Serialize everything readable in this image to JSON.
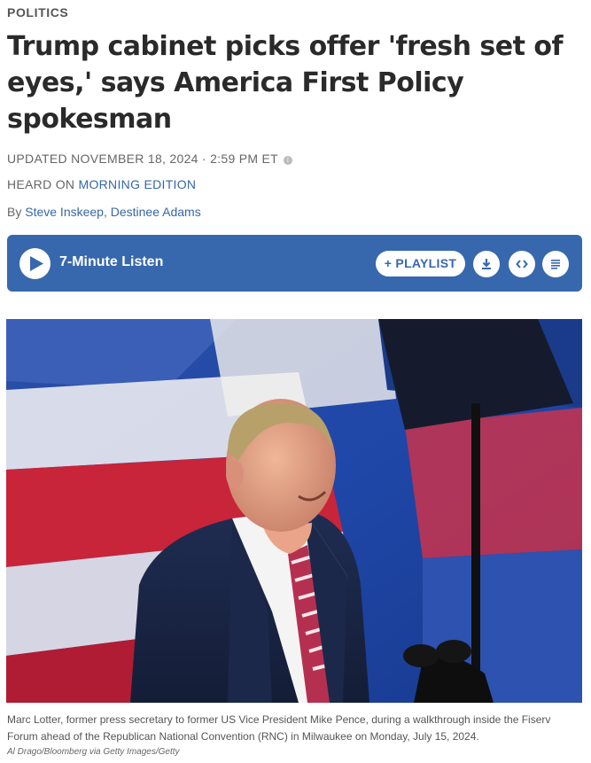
{
  "section": "POLITICS",
  "headline": "Trump cabinet picks offer 'fresh set of eyes,' says America First Policy spokesman",
  "updated": "UPDATED NOVEMBER 18, 2024 · 2:59 PM ET",
  "heard": {
    "prefix": "HEARD ON ",
    "program": "MORNING EDITION"
  },
  "byline": {
    "prefix": "By ",
    "author1": "Steve Inskeep",
    "sep": ", ",
    "author2": "Destinee Adams"
  },
  "player": {
    "listen_label": "7-Minute Listen",
    "playlist_label": "+ PLAYLIST"
  },
  "photo": {
    "caption": "Marc Lotter, former press secretary to former US Vice President Mike Pence, during a walkthrough inside the Fiserv Forum ahead of the Republican National Convention (RNC) in Milwaukee on Monday, July 15, 2024.",
    "credit": "Al Drago/Bloomberg via Getty Images/Getty"
  },
  "colors": {
    "player_bg": "#3768ad",
    "link": "#3567a8"
  },
  "icons": [
    "info-icon",
    "play-icon",
    "download-icon",
    "embed-icon",
    "transcript-icon"
  ]
}
